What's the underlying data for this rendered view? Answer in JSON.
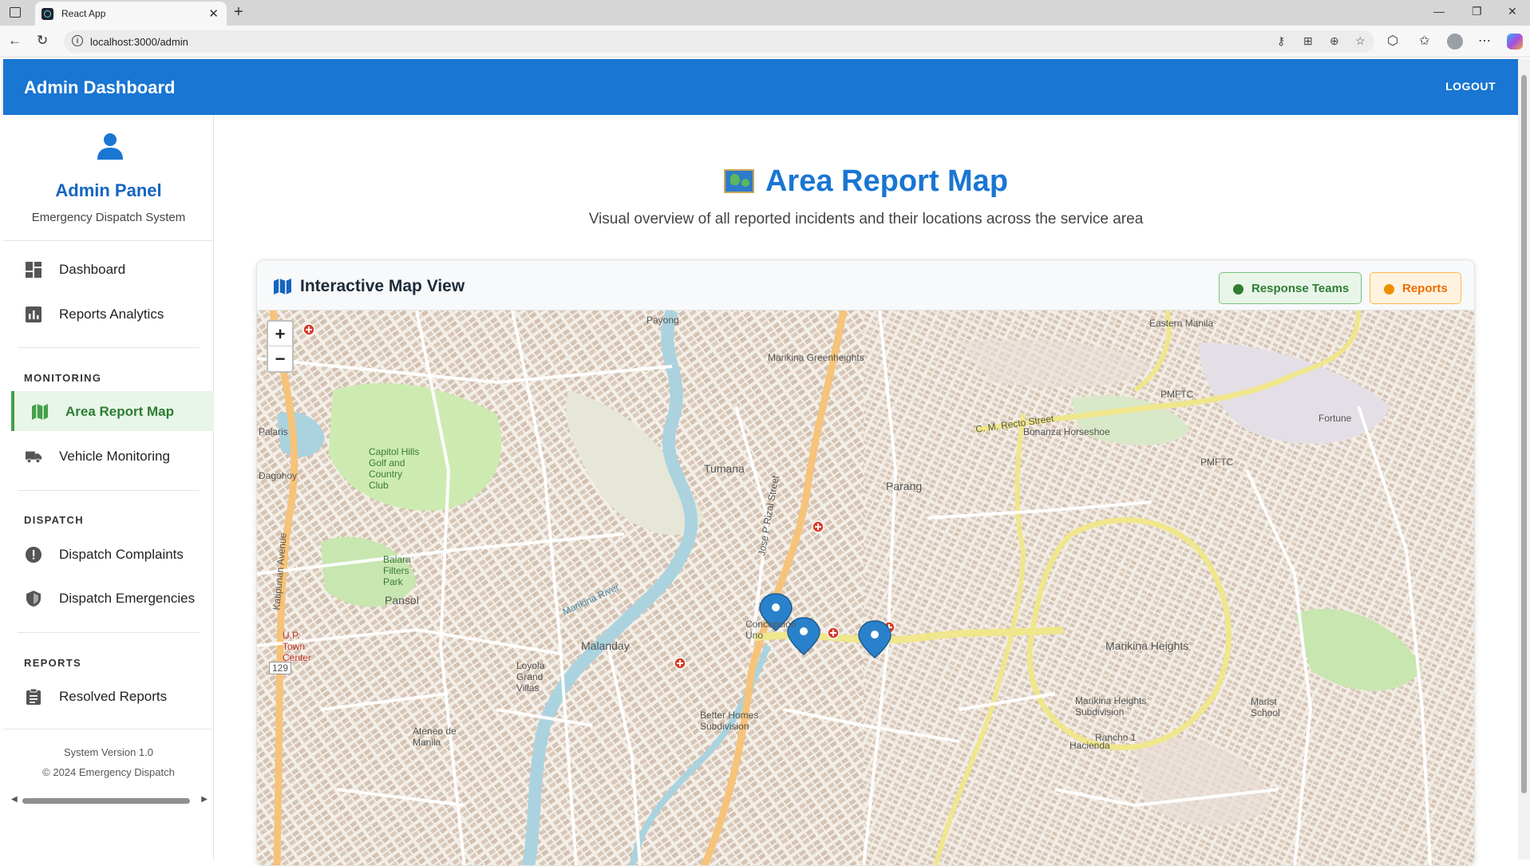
{
  "browser": {
    "tab_title": "React App",
    "url": "localhost:3000/admin"
  },
  "appbar": {
    "title": "Admin Dashboard",
    "logout_label": "LOGOUT"
  },
  "sidebar": {
    "title": "Admin Panel",
    "subtitle": "Emergency Dispatch System",
    "items": [
      {
        "label": "Dashboard",
        "icon": "dashboard-icon"
      },
      {
        "label": "Reports Analytics",
        "icon": "analytics-icon"
      }
    ],
    "sections": [
      {
        "heading": "MONITORING",
        "items": [
          {
            "label": "Area Report Map",
            "icon": "map-icon",
            "active": true
          },
          {
            "label": "Vehicle Monitoring",
            "icon": "truck-icon"
          }
        ]
      },
      {
        "heading": "DISPATCH",
        "items": [
          {
            "label": "Dispatch Complaints",
            "icon": "alert-icon"
          },
          {
            "label": "Dispatch Emergencies",
            "icon": "shield-icon"
          }
        ]
      },
      {
        "heading": "REPORTS",
        "items": [
          {
            "label": "Resolved Reports",
            "icon": "clipboard-icon"
          }
        ]
      }
    ],
    "footer": {
      "version": "System Version 1.0",
      "copyright": "© 2024 Emergency Dispatch"
    }
  },
  "main": {
    "title": "Area Report Map",
    "subtitle": "Visual overview of all reported incidents and their locations across the service area",
    "card": {
      "title": "Interactive Map View",
      "legend": {
        "teams_label": "Response Teams",
        "reports_label": "Reports",
        "teams_color": "#2e7d32",
        "reports_color": "#ef8f00"
      },
      "zoom_in": "+",
      "zoom_out": "−",
      "map_labels": {
        "payong": "Payong",
        "greenheights": "Marikina Greenheights",
        "pmftc": "PMFTC",
        "fortune": "Fortune",
        "tumana": "Tumana",
        "parang": "Parang",
        "capitol": "Capitol Hills Golf and Country Club",
        "balara": "Balara Filters Park",
        "pansol": "Pansol",
        "concepcion": "Concepcion Uno",
        "marikina_heights": "Marikina Heights",
        "malanday": "Malanday",
        "loyola": "Loyola Grand Villas",
        "better_homes": "Better Homes Subdivision",
        "mh_subdivision": "Marikina Heights Subdivision",
        "marikina_river": "Marikina River",
        "jose_rizal": "Jose P Rizal Street",
        "katipunan": "Katipunan Avenue",
        "cm_recto": "C. M. Recto Street",
        "bonanza": "Bonanza Horseshoe",
        "rancho": "Rancho 1",
        "hacienda": "Hacienda",
        "ateneo": "Ateneo de Manila",
        "up_town": "U.P. Town Center",
        "dagohoy": "Dagohoy",
        "palaris": "Palaris",
        "eastern_manila": "Eastern Manila",
        "marist": "Marist School",
        "route": "129"
      }
    }
  }
}
